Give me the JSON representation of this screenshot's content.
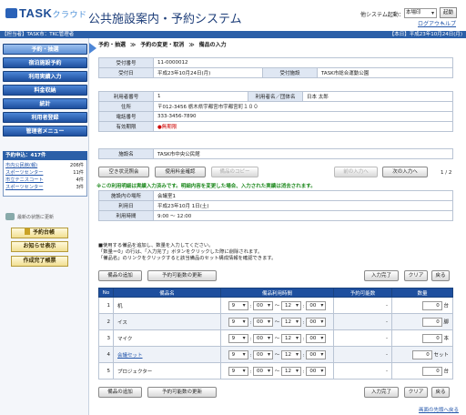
{
  "header": {
    "logo": "TASK",
    "logo_sub": "クラウド",
    "title": "公共施設案内・予約システム",
    "startup_label": "他システム起動：",
    "startup_value": "本場印",
    "startup_button": "起動",
    "logout": "ログアウト",
    "help": "ヘルプ"
  },
  "infobar": {
    "left": "【担当者】TASK市：TKC管理者",
    "right": "【本日】平成23年10月24日(月)"
  },
  "sidebar": {
    "nav": [
      "予約・抽選",
      "宿泊施設予約",
      "利用実績入力",
      "料金収納",
      "統計",
      "利用者登録",
      "管理者メニュー"
    ],
    "stats_title": "予約申込：417件",
    "stats": [
      {
        "name": "市内公民館(報)",
        "count": "206件"
      },
      {
        "name": "スポーツセンター",
        "count": "11件"
      },
      {
        "name": "市立テニスコート",
        "count": "4件"
      },
      {
        "name": "スポーツセンター",
        "count": "3件"
      }
    ],
    "refresh": "最新の状態に更新",
    "side_buttons": [
      "予約台帳",
      "お知らせ表示",
      "作成完了帳票"
    ]
  },
  "breadcrumb": [
    "予約・抽選",
    "予約の変更・取消",
    "備品の入力"
  ],
  "reservation": {
    "no_label": "受付番号",
    "no_value": "11-0000012",
    "date_label": "受付日",
    "date_value": "平成23年10月24日(月)",
    "facility_label": "受付施設",
    "facility_value": "TASK市総合運動公園"
  },
  "user": {
    "id_label": "利用者番号",
    "id_value": "1",
    "name_label": "利用者名／団体名",
    "name_value": "日本 太郎",
    "address_label": "住所",
    "address_value": "〒012-3456 栃木県宇都宮市宇都宮町１００",
    "phone_label": "電話番号",
    "phone_value": "333-3456-7890",
    "validity_label": "有効期限",
    "validity_value": "●無期限"
  },
  "facility": {
    "label": "施設名",
    "value": "TASK市中央公民館"
  },
  "actions": {
    "status": "空き状況照会",
    "fee": "使用料金確認",
    "copy": "備品のコピー",
    "prev": "前の入力へ",
    "next": "次の入力へ",
    "page": "1 / 2"
  },
  "warning": "※この利用明細は実績入力済みです。明細内容を変更した場合、入力された実績は消去されます。",
  "usage": {
    "place_label": "施設内の場所",
    "place_value": "会議室1",
    "date_label": "利用日",
    "date_value": "平成23年10月 1日(土)",
    "time_label": "利用時間",
    "time_value": "9:00 ～ 12:00"
  },
  "notes": [
    "■使用する備品を追加し、数量を入力してください。",
    "「数量＝0」の行は、「入力完了」ボタンをクリックした際に削除されます。",
    "「備品名」のリンクをクリックすると該当備品のセット構成情報を確認できます。"
  ],
  "toolbar": {
    "add": "備品の追加",
    "refresh": "予約可能数の更新",
    "done": "入力完了",
    "clear": "クリア",
    "back": "戻る"
  },
  "equipment_table": {
    "headers": [
      "No",
      "備品名",
      "備品利用時間",
      "予約可能数",
      "数量"
    ],
    "rows": [
      {
        "no": "1",
        "name": "机",
        "h1": "9",
        "m1": "00",
        "h2": "12",
        "m2": "00",
        "stock": "-",
        "qty": "0",
        "unit": "台"
      },
      {
        "no": "2",
        "name": "イス",
        "h1": "9",
        "m1": "00",
        "h2": "12",
        "m2": "00",
        "stock": "-",
        "qty": "0",
        "unit": "脚"
      },
      {
        "no": "3",
        "name": "マイク",
        "h1": "9",
        "m1": "00",
        "h2": "12",
        "m2": "00",
        "stock": "-",
        "qty": "0",
        "unit": "本"
      },
      {
        "no": "4",
        "name": "会議セット",
        "h1": "9",
        "m1": "00",
        "h2": "12",
        "m2": "00",
        "stock": "-",
        "qty": "0",
        "unit": "セット"
      },
      {
        "no": "5",
        "name": "プロジェクター",
        "h1": "9",
        "m1": "00",
        "h2": "12",
        "m2": "00",
        "stock": "-",
        "qty": "0",
        "unit": "台"
      }
    ],
    "colon": ":",
    "tilde": "～"
  },
  "bottom_link": "画面の先頭へ戻る"
}
